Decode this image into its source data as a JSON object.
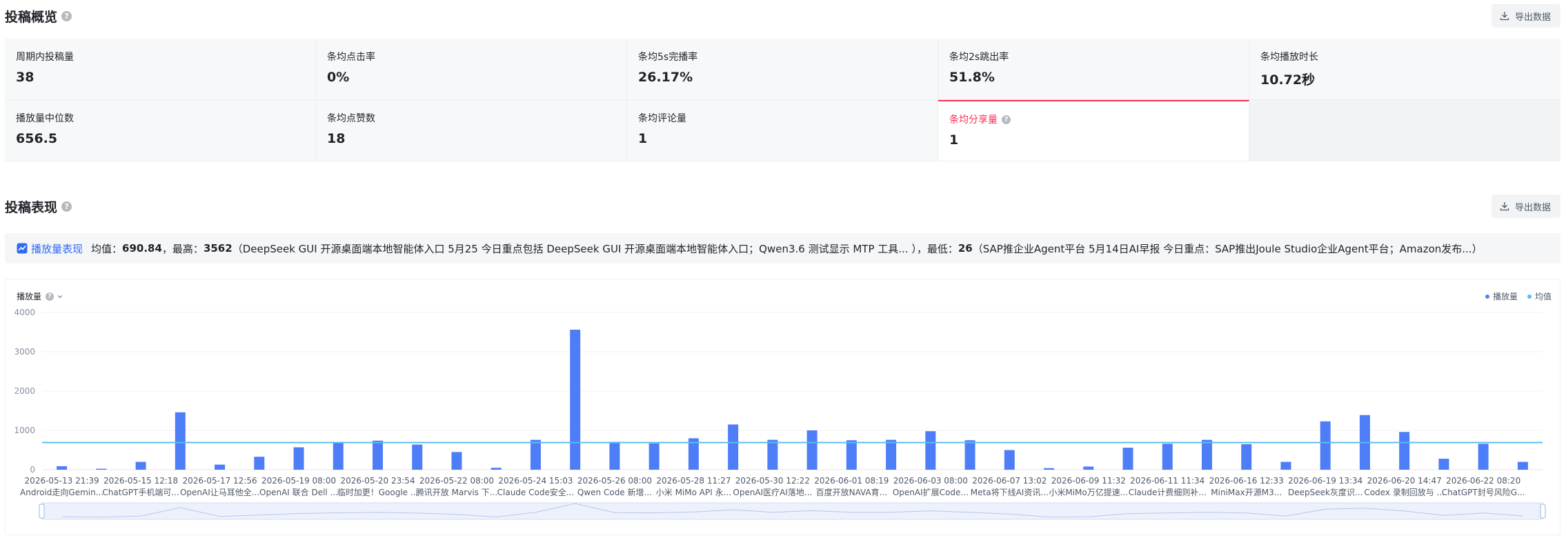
{
  "overview": {
    "title": "投稿概览",
    "export_label": "导出数据",
    "stats": [
      {
        "label": "周期内投稿量",
        "value": "38"
      },
      {
        "label": "条均点击率",
        "value": "0%"
      },
      {
        "label": "条均5s完播率",
        "value": "26.17%"
      },
      {
        "label": "条均2s跳出率",
        "value": "51.8%"
      },
      {
        "label": "条均播放时长",
        "value": "10.72秒"
      },
      {
        "label": "播放量中位数",
        "value": "656.5"
      },
      {
        "label": "条均点赞数",
        "value": "18"
      },
      {
        "label": "条均评论量",
        "value": "1"
      },
      {
        "label": "条均分享量",
        "value": "1"
      }
    ]
  },
  "performance": {
    "title": "投稿表现",
    "export_label": "导出数据",
    "summary": {
      "link_label": "播放量表现",
      "avg_label": "均值：",
      "avg_value": "690.84",
      "max_label": "，最高：",
      "max_value": "3562",
      "max_detail": "（DeepSeek GUI 开源桌面端本地智能体入口 5月25 今日重点包括 DeepSeek GUI 开源桌面端本地智能体入口；Qwen3.6 测试显示 MTP 工具... ），",
      "min_label": "最低：",
      "min_value": "26",
      "min_detail": "（SAP推企业Agent平台 5月14日AI早报 今日重点：SAP推出Joule Studio企业Agent平台；Amazon发布...）"
    }
  },
  "chart_meta": {
    "metric_label": "播放量",
    "legend_bar": "播放量",
    "legend_avg": "均值",
    "bar_color": "#4e7ef7",
    "avg_color": "#5bbcf2"
  },
  "chart_data": {
    "type": "bar",
    "ylim": [
      0,
      4000
    ],
    "yticks": [
      0,
      1000,
      2000,
      3000,
      4000
    ],
    "average": 690.84,
    "values": [
      90,
      26,
      200,
      1460,
      130,
      330,
      570,
      680,
      740,
      640,
      450,
      50,
      760,
      3562,
      710,
      670,
      800,
      1150,
      760,
      1000,
      750,
      760,
      980,
      750,
      500,
      40,
      80,
      560,
      660,
      760,
      650,
      200,
      1230,
      1390,
      960,
      280,
      660,
      200
    ],
    "date_labels": [
      "2026-05-13 21:39",
      "2026-05-15 12:18",
      "2026-05-17 12:56",
      "2026-05-19 08:00",
      "2026-05-20 23:54",
      "2026-05-22 08:00",
      "2026-05-24 15:03",
      "2026-05-26 08:00",
      "2026-05-28 11:27",
      "2026-05-30 12:22",
      "2026-06-01 08:19",
      "2026-06-03 08:00",
      "2026-06-07 13:02",
      "2026-06-09 11:32",
      "2026-06-11 11:34",
      "2026-06-16 12:33",
      "2026-06-19 13:34",
      "2026-06-20 14:47",
      "2026-06-22 08:20"
    ],
    "title_labels": [
      "Android走向Gemin...",
      "ChatGPT手机端可...",
      "OpenAI让马耳他全...",
      "OpenAI 联合 Dell ...",
      "临时加更！Google ...",
      "腾讯开放 Marvis 下...",
      "Claude Code安全...",
      "Qwen Code 新增...",
      "小米 MiMo API 永...",
      "OpenAI医疗AI落地...",
      "百度开放NAVA育...",
      "OpenAI扩展Code...",
      "Meta将下线AI资讯...",
      "小米MiMo万亿提速...",
      "Claude计费细则补...",
      "MiniMax开源M3...",
      "DeepSeek灰度识...",
      "Codex 录制回放与 ...",
      "ChatGPT封号风险G..."
    ]
  }
}
